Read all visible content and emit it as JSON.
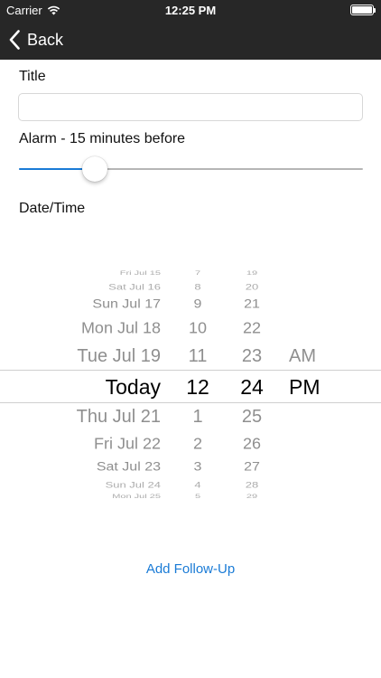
{
  "status_bar": {
    "carrier": "Carrier",
    "time": "12:25 PM"
  },
  "nav": {
    "back_label": "Back"
  },
  "form": {
    "title_label": "Title",
    "title_value": "",
    "title_placeholder": "",
    "alarm_label": "Alarm - 15 minutes before",
    "alarm_slider_fraction": 0.22,
    "datetime_label": "Date/Time"
  },
  "picker": {
    "dates": [
      "Fri Jul 15",
      "Sat Jul 16",
      "Sun Jul 17",
      "Mon Jul 18",
      "Tue Jul 19",
      "Today",
      "Thu Jul 21",
      "Fri Jul 22",
      "Sat Jul 23",
      "Sun Jul 24",
      "Mon Jul 25"
    ],
    "hours": [
      "7",
      "8",
      "9",
      "10",
      "11",
      "12",
      "1",
      "2",
      "3",
      "4",
      "5"
    ],
    "minutes": [
      "19",
      "20",
      "21",
      "22",
      "23",
      "24",
      "25",
      "26",
      "27",
      "28",
      "29"
    ],
    "ampm": [
      "AM",
      "PM"
    ],
    "selected_date": "Today",
    "selected_hour": "12",
    "selected_minute": "24",
    "selected_period": "PM"
  },
  "actions": {
    "add_follow_up": "Add Follow-Up"
  },
  "colors": {
    "accent": "#1a7bd6",
    "nav_background": "#272727"
  }
}
